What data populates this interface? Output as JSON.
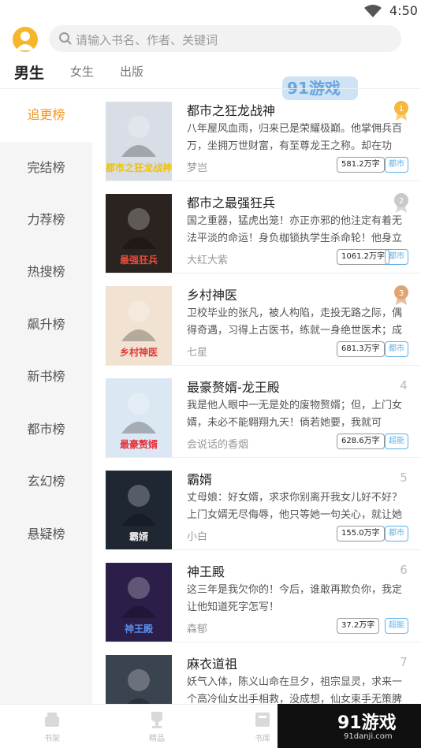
{
  "status_bar": {
    "time": "4:50"
  },
  "search": {
    "placeholder": "请输入书名、作者、关键词"
  },
  "gender_tabs": [
    {
      "label": "男生",
      "active": true
    },
    {
      "label": "女生",
      "active": false
    },
    {
      "label": "出版",
      "active": false
    }
  ],
  "sidebar": {
    "items": [
      {
        "label": "追更榜",
        "active": true
      },
      {
        "label": "完结榜"
      },
      {
        "label": "力荐榜"
      },
      {
        "label": "热搜榜"
      },
      {
        "label": "飙升榜"
      },
      {
        "label": "新书榜"
      },
      {
        "label": "都市榜"
      },
      {
        "label": "玄幻榜"
      },
      {
        "label": "悬疑榜"
      }
    ]
  },
  "books": [
    {
      "title": "都市之狂龙战神",
      "desc": "八年屋风血雨，归来已是荣耀极巅。他掌佣兵百万，坐拥万世财富，有至尊龙王之称。却在功成...",
      "author": "梦岂",
      "words": "581.2万字",
      "tag": "都市",
      "rank": "1",
      "medal": "gold"
    },
    {
      "title": "都市之最强狂兵",
      "desc": "国之重器，猛虎出笼！亦正亦邪的他注定有着无法平淡的命运！身负枷锁执学生杀命轮！他身立潮...",
      "author": "大红大紫",
      "words": "1061.2万字",
      "tag": "都市",
      "rank": "2",
      "medal": "silver"
    },
    {
      "title": "乡村神医",
      "desc": "卫校毕业的张凡，被人构陷，走投无路之际，偶得奇遇，习得上古医书，练就一身绝世医术；成就...",
      "author": "七星",
      "words": "681.3万字",
      "tag": "都市",
      "rank": "3",
      "medal": "bronze"
    },
    {
      "title": "最豪赘婿-龙王殿",
      "desc": "我是他人眼中一无是处的废物赘婿；但，上门女婿，未必不能翱翔九天！倘若她要，我就可以，...",
      "author": "会说话的香烟",
      "words": "628.6万字",
      "tag": "超能",
      "rank": "4",
      "medal": ""
    },
    {
      "title": "霸婿",
      "desc": "丈母娘：好女婿，求求你别离开我女儿好不好？上门女婿无尽侮辱，他只等她一句关心，就让她捐...",
      "author": "小白",
      "words": "155.0万字",
      "tag": "都市",
      "rank": "5",
      "medal": ""
    },
    {
      "title": "神王殿",
      "desc": "这三年是我欠你的！今后，谁敢再欺负你，我定让他知道死字怎写！",
      "author": "森郁",
      "words": "37.2万字",
      "tag": "超能",
      "rank": "6",
      "medal": ""
    },
    {
      "title": "麻衣道祖",
      "desc": "妖气入体，陈义山命在旦夕，祖宗显灵，求来一个高冷仙女出手相救，没成想，仙女束手无策脾气...",
      "author": "",
      "words": "",
      "tag": "",
      "rank": "7",
      "medal": ""
    }
  ],
  "covers": [
    {
      "caption": "都市之狂龙战神",
      "bg": "#d9dde6"
    },
    {
      "caption": "最强狂兵",
      "bg": "#2a2320"
    },
    {
      "caption": "乡村神医",
      "bg": "#f1e2d2"
    },
    {
      "caption": "最豪赘婿",
      "bg": "#dbe7f2"
    },
    {
      "caption": "霸婿",
      "bg": "#1f2733"
    },
    {
      "caption": "神王殿",
      "bg": "#2b1f4a"
    },
    {
      "caption": "",
      "bg": "#3a4350"
    }
  ],
  "watermark_top": {
    "text": "91游戏",
    "sub": "91danji.com"
  },
  "tabbar": [
    {
      "label": "书架"
    },
    {
      "label": "精品"
    },
    {
      "label": "书库"
    }
  ],
  "watermark": {
    "main": "91游戏",
    "sub": "91danji.com"
  },
  "colors": {
    "accent": "#f7941d",
    "tag_blue": "#5ab1e8",
    "avatar": "#f7b52c"
  }
}
